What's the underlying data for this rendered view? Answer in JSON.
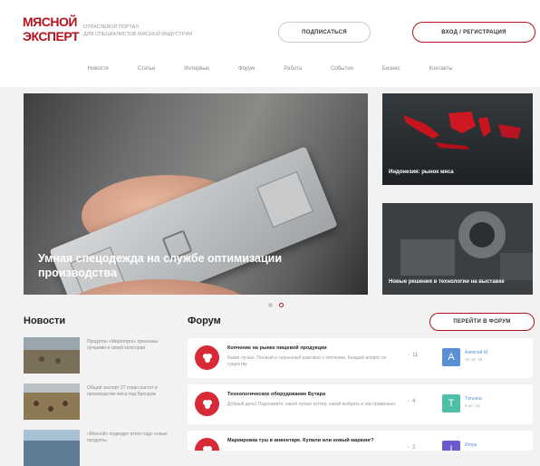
{
  "header": {
    "logo_line1": "МЯСНОЙ",
    "logo_line2": "ЭКСПЕРТ",
    "tagline_line1": "ОТРАСЛЕВОЙ ПОРТАЛ",
    "tagline_line2": "ДЛЯ СПЕЦИАЛИСТОВ МЯСНОЙ ИНДУСТРИИ",
    "subscribe_label": "ПОДПИСАТЬСЯ",
    "login_label": "ВХОД / РЕГИСТРАЦИЯ",
    "brand_color": "#b3121f"
  },
  "nav": {
    "items": [
      "Новости",
      "Статьи",
      "Интервью",
      "Форум",
      "Работа",
      "События",
      "Бизнес",
      "Контакты"
    ]
  },
  "slider": {
    "main_title": "Умная спецодежда на службе оптимизации производства",
    "side_cards": [
      {
        "caption": "Индонезия: рынок мяса"
      },
      {
        "caption": "Новые решения в технологии на выставке"
      }
    ],
    "dots": 2,
    "active_dot": 2
  },
  "news": {
    "title": "Новости",
    "items": [
      {
        "text": "Продукты «Мираторга» признаны лучшими в своей категории"
      },
      {
        "text": "Общий экспорт 27 стран растет в производстве мяса под брендом"
      },
      {
        "text": "«Мясной» подводит итоги года: новые продукты"
      }
    ]
  },
  "forum": {
    "title": "Форум",
    "go_button": "ПЕРЕЙТИ В ФОРУМ",
    "rows": [
      {
        "title": "Копчение на рынке пищевой продукции",
        "desc": "Какие лучше. Полный и серьезный разговор о копчении. Каждый вопрос по существу.",
        "count": "11",
        "avatar_letter": "A",
        "avatar_color": "#5a8fd6",
        "author": "Алексей М.",
        "date": "10 окт 18"
      },
      {
        "title": "Технологическое оборудование Бутара",
        "desc": "Добрый день! Подскажите, какой лучше куттер, какой выбрать и как правильно.",
        "count": "4",
        "avatar_letter": "T",
        "avatar_color": "#4fbfa8",
        "author": "Татьяна",
        "date": "9 окт 18"
      },
      {
        "title": "Маркировка туш в инвентаре. Купили или новый маркинг?",
        "desc": "",
        "count": "2",
        "avatar_letter": "I",
        "avatar_color": "#6a5acd",
        "author": "Игорь",
        "date": ""
      }
    ]
  }
}
